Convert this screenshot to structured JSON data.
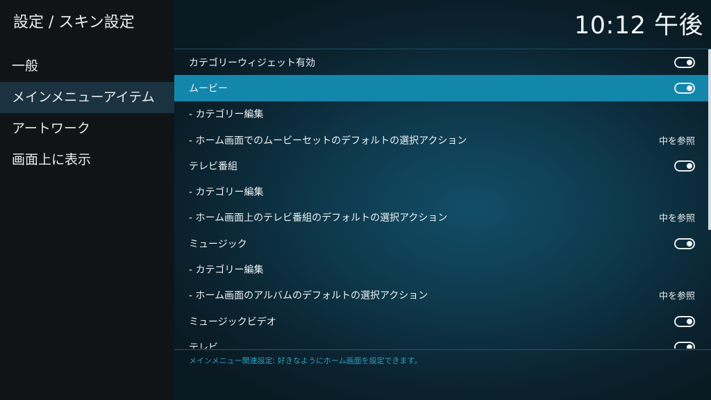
{
  "header": {
    "breadcrumb": "設定 / スキン設定",
    "clock": "10:12 午後"
  },
  "sidebar": {
    "items": [
      {
        "label": "一般"
      },
      {
        "label": "メインメニューアイテム",
        "focused": true
      },
      {
        "label": "アートワーク"
      },
      {
        "label": "画面上に表示"
      }
    ]
  },
  "settings": {
    "rows": [
      {
        "label": "カテゴリーウィジェット有効",
        "control": "toggle",
        "on": true
      },
      {
        "label": "ムービー",
        "control": "toggle",
        "on": true,
        "focused": true
      },
      {
        "label": "- カテゴリー編集"
      },
      {
        "label": "- ホーム画面でのムービーセットのデフォルトの選択アクション",
        "value": "中を参照"
      },
      {
        "label": "テレビ番組",
        "control": "toggle",
        "on": true
      },
      {
        "label": "- カテゴリー編集"
      },
      {
        "label": "- ホーム画面上のテレビ番組のデフォルトの選択アクション",
        "value": "中を参照"
      },
      {
        "label": "ミュージック",
        "control": "toggle",
        "on": true
      },
      {
        "label": "- カテゴリー編集"
      },
      {
        "label": "- ホーム画面のアルバムのデフォルトの選択アクション",
        "value": "中を参照"
      },
      {
        "label": "ミュージックビデオ",
        "control": "toggle",
        "on": true
      },
      {
        "label": "テレビ",
        "control": "toggle",
        "on": true
      }
    ]
  },
  "footer": {
    "description": "メインメニュー関連設定: 好きなようにホーム画面を設定できます。"
  },
  "colors": {
    "focus_row": "#1387ab",
    "sidebar_focus": "#1b3240",
    "footer_text": "#2e9fc4"
  }
}
